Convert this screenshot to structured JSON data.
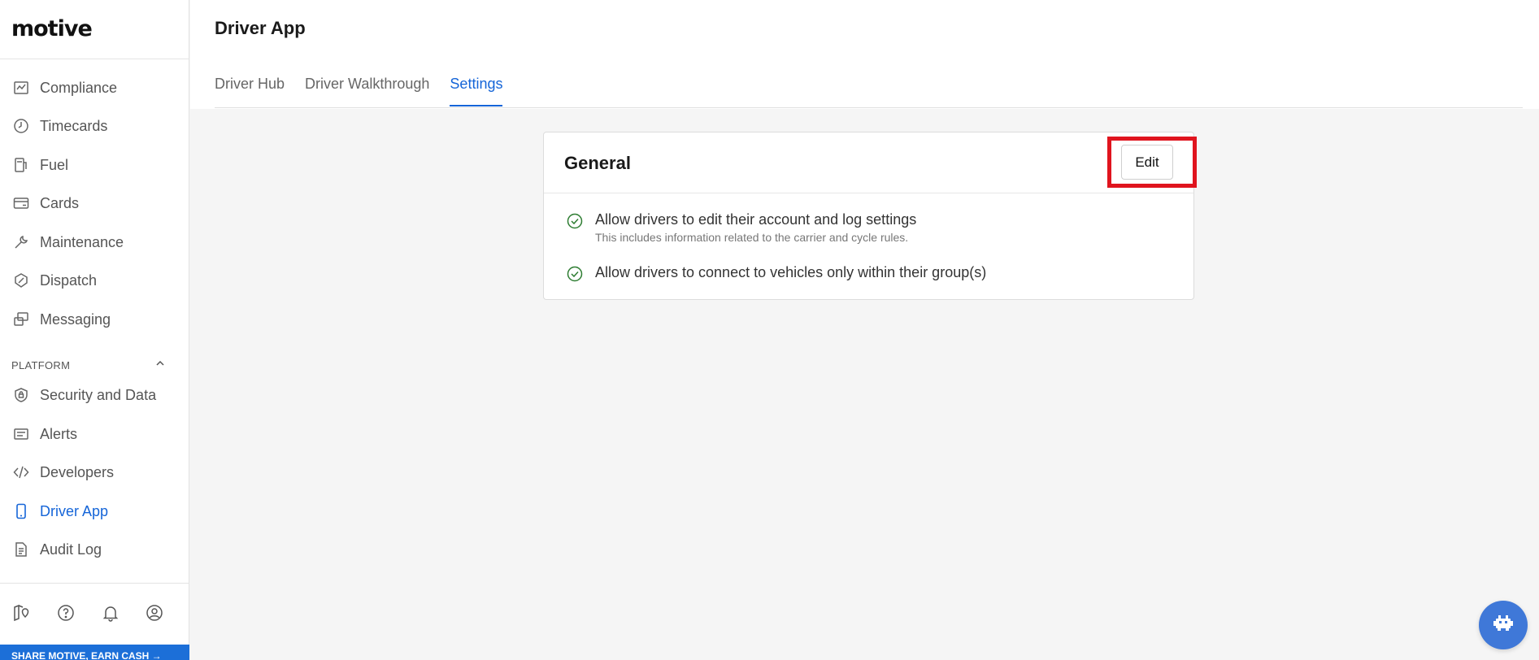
{
  "brand": {
    "logo_text": "motive"
  },
  "sidebar": {
    "items": [
      {
        "label": "Compliance",
        "icon": "compliance-icon"
      },
      {
        "label": "Timecards",
        "icon": "clock-icon"
      },
      {
        "label": "Fuel",
        "icon": "fuel-pump-icon"
      },
      {
        "label": "Cards",
        "icon": "credit-card-icon"
      },
      {
        "label": "Maintenance",
        "icon": "wrench-icon"
      },
      {
        "label": "Dispatch",
        "icon": "dispatch-icon"
      },
      {
        "label": "Messaging",
        "icon": "messaging-icon"
      }
    ],
    "platform_section": {
      "title": "PLATFORM",
      "expanded": true
    },
    "platform_items": [
      {
        "label": "Security and Data",
        "icon": "shield-lock-icon"
      },
      {
        "label": "Alerts",
        "icon": "alerts-icon"
      },
      {
        "label": "Developers",
        "icon": "code-icon"
      },
      {
        "label": "Driver App",
        "icon": "phone-icon",
        "active": true
      },
      {
        "label": "Audit Log",
        "icon": "document-icon"
      }
    ],
    "bottom_icons": [
      "map-pin-icon",
      "help-icon",
      "bell-icon",
      "user-circle-icon"
    ],
    "promo_text": "SHARE MOTIVE, EARN CASH →"
  },
  "header": {
    "title": "Driver App",
    "tabs": [
      {
        "label": "Driver Hub"
      },
      {
        "label": "Driver Walkthrough"
      },
      {
        "label": "Settings",
        "active": true
      }
    ]
  },
  "card": {
    "title": "General",
    "edit_label": "Edit",
    "settings": [
      {
        "label": "Allow drivers to edit their account and log settings",
        "sub": "This includes information related to the carrier and cycle rules."
      },
      {
        "label": "Allow drivers to connect to vehicles only within their group(s)",
        "sub": ""
      }
    ]
  },
  "colors": {
    "accent": "#1565d8",
    "highlight": "#e0141e",
    "check": "#2e7d32",
    "fab": "#3f78d8"
  }
}
